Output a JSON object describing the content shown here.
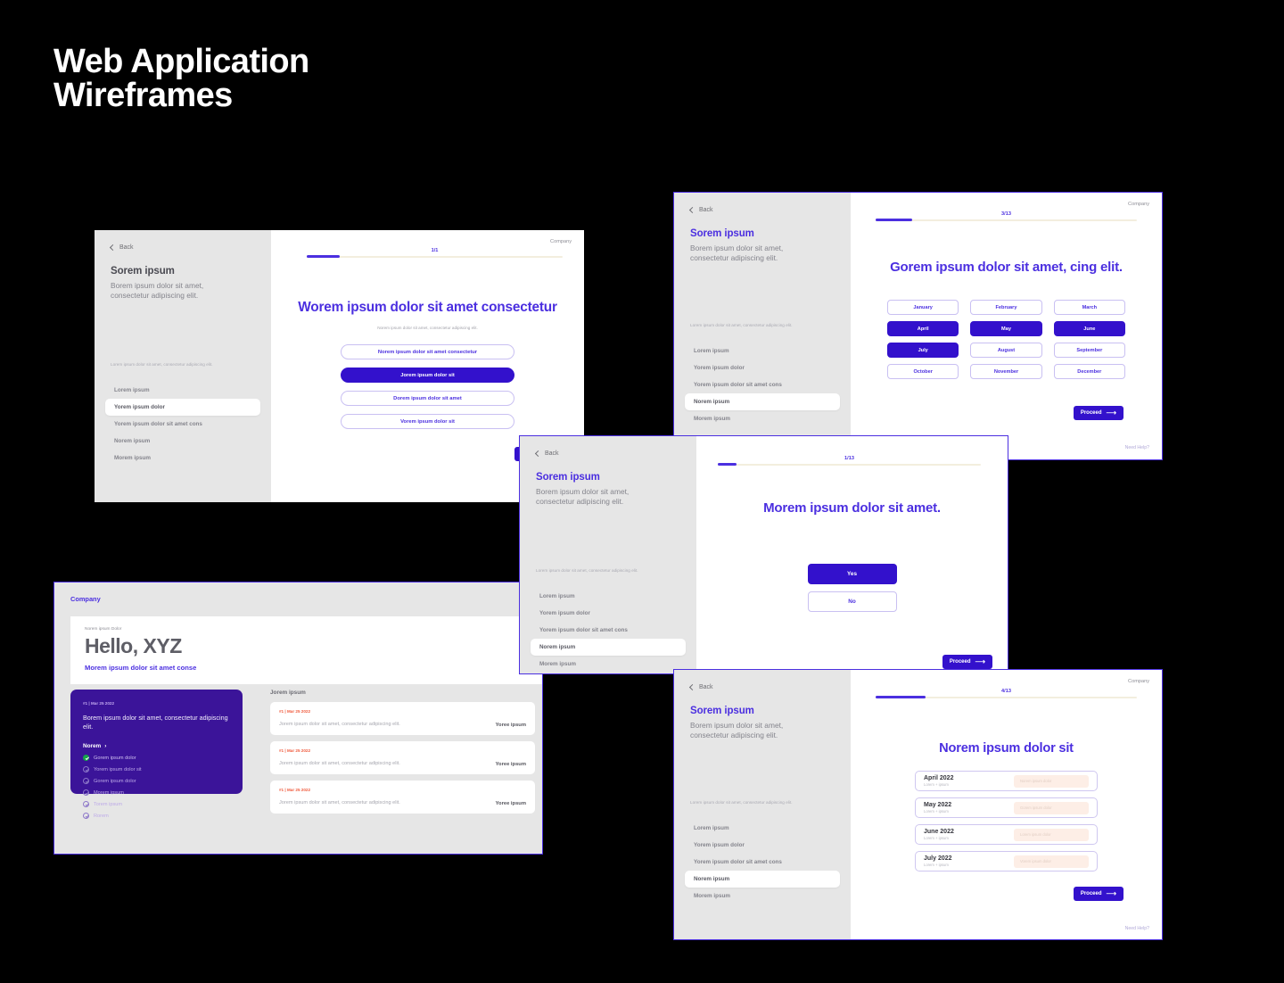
{
  "page": {
    "title": "Web Application\nWireframes"
  },
  "common": {
    "back_label": "Back",
    "company_label": "Company",
    "side_title": "Sorem ipsum",
    "side_sub": "Borem ipsum dolor sit amet,\nconsectetur adipiscing elit.",
    "side_note": "Lorem ipsum dolor sit amet, consectetur adipiscing elit.",
    "side_items": [
      "Lorem ipsum",
      "Yorem ipsum dolor",
      "Yorem ipsum dolor sit amet cons",
      "Norem ipsum",
      "Morem ipsum"
    ],
    "proceed_label": "Proceed",
    "proceed_arrow": "⟶",
    "need_help_label": "Need Help?"
  },
  "colors": {
    "accent": "#3311CC",
    "accent_text": "#4B2FE0",
    "deep_purple": "#3B1499",
    "progress_track": "#F3EEDE",
    "orange": "#F05A3C",
    "green": "#16A34A",
    "sidebar_bg": "#E6E6E6",
    "page_bg": "#000000"
  },
  "card1": {
    "active_index": 1,
    "progress": {
      "label": "1/1",
      "percent": 13
    },
    "heading": "Worem ipsum dolor sit amet consectetur",
    "subheading": "Norem ipsum dolor sit amet, consectetur adipiscing elit.",
    "options": [
      {
        "label": "Norem ipsum dolor sit amet consectetur",
        "selected": false
      },
      {
        "label": "Jorem ipsum dolor sit",
        "selected": true
      },
      {
        "label": "Dorem ipsum dolor sit amet",
        "selected": false
      },
      {
        "label": "Vorem ipsum dolor sit",
        "selected": false
      }
    ]
  },
  "card2": {
    "active_index": 3,
    "progress": {
      "label": "1/13",
      "percent": 7
    },
    "heading": "Morem ipsum dolor sit amet.",
    "answers": [
      {
        "label": "Yes",
        "selected": true
      },
      {
        "label": "No",
        "selected": false
      }
    ]
  },
  "card3": {
    "active_index": 3,
    "progress": {
      "label": "3/13",
      "percent": 23
    },
    "heading": "Gorem ipsum dolor sit amet, cing elit.",
    "months": [
      {
        "label": "January",
        "selected": false
      },
      {
        "label": "February",
        "selected": false
      },
      {
        "label": "March",
        "selected": false
      },
      {
        "label": "April",
        "selected": true
      },
      {
        "label": "May",
        "selected": true
      },
      {
        "label": "June",
        "selected": true
      },
      {
        "label": "July",
        "selected": true
      },
      {
        "label": "August",
        "selected": false
      },
      {
        "label": "September",
        "selected": false
      },
      {
        "label": "October",
        "selected": false
      },
      {
        "label": "November",
        "selected": false
      },
      {
        "label": "December",
        "selected": false
      }
    ]
  },
  "card4": {
    "active_index": 3,
    "progress": {
      "label": "4/13",
      "percent": 30
    },
    "heading": "Norem ipsum dolor sit",
    "rows": [
      {
        "label": "April 2022",
        "sub": "Lorem + ipsum",
        "placeholder": "Norem ipsum dolor"
      },
      {
        "label": "May 2022",
        "sub": "Lorem + ipsum",
        "placeholder": "Gorem ipsum dolor"
      },
      {
        "label": "June 2022",
        "sub": "Lorem + ipsum",
        "placeholder": "Lorem ipsum dolor"
      },
      {
        "label": "July 2022",
        "sub": "Lorem + ipsum",
        "placeholder": "Vorem ipsum dolor"
      }
    ]
  },
  "dashboard": {
    "company_label": "Company",
    "hero": {
      "eyebrow": "Norem ipsum Dolor",
      "title": "Hello, XYZ",
      "subtitle": "Morem ipsum dolor sit amet conse"
    },
    "highlight_card": {
      "meta": "#1 | Mar 25 2022",
      "body": "Borem ipsum dolor sit amet, consectetur adipiscing elit.",
      "link_label": "Norem",
      "link_arrow": "›",
      "checklist": [
        {
          "label": "Gorem ipsum dolor",
          "done": true
        },
        {
          "label": "Yorem ipsum dolor sit",
          "done": false
        },
        {
          "label": "Gorem ipsum dolor",
          "done": false
        },
        {
          "label": "Morem ipsum",
          "done": false
        },
        {
          "label": "Torem ipsum",
          "done": false
        },
        {
          "label": "Rorem",
          "done": false
        }
      ]
    },
    "list": {
      "heading": "Jorem ipsum",
      "rows": [
        {
          "meta": "#1 | Mar 25 2022",
          "body": "Jorem ipsum dolor sit amet, consectetur adipiscing elit.",
          "right": "Yoree ipsum"
        },
        {
          "meta": "#1 | Mar 25 2022",
          "body": "Jorem ipsum dolor sit amet, consectetur adipiscing elit.",
          "right": "Yoree ipsum"
        },
        {
          "meta": "#1 | Mar 25 2022",
          "body": "Jorem ipsum dolor sit amet, consectetur adipiscing elit.",
          "right": "Yoree ipsum"
        }
      ]
    }
  }
}
